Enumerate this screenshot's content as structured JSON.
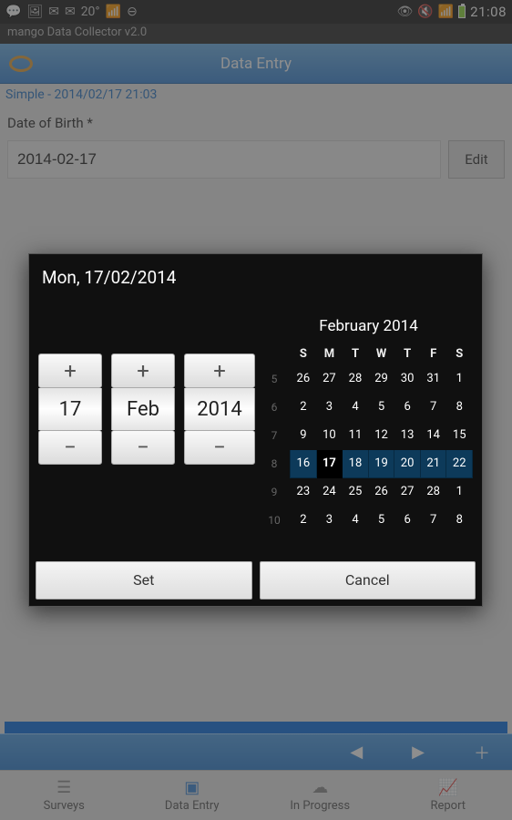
{
  "status": {
    "temp": "20°",
    "clock": "21:08"
  },
  "app": {
    "title": "mango Data Collector v2.0",
    "header": "Data Entry",
    "breadcrumb": "Simple - 2014/02/17 21:03"
  },
  "form": {
    "dob_label": "Date of Birth *",
    "dob_value": "2014-02-17",
    "edit_label": "Edit"
  },
  "tabs": {
    "surveys": "Surveys",
    "data_entry": "Data Entry",
    "in_progress": "In Progress",
    "report": "Report"
  },
  "dialog": {
    "title": "Mon, 17/02/2014",
    "day": "17",
    "month": "Feb",
    "year": "2014",
    "set_label": "Set",
    "cancel_label": "Cancel"
  },
  "calendar": {
    "title": "February 2014",
    "dow": [
      "S",
      "M",
      "T",
      "W",
      "T",
      "F",
      "S"
    ],
    "weeks": [
      {
        "wk": "5",
        "days": [
          {
            "d": "26",
            "dim": true
          },
          {
            "d": "27",
            "dim": true
          },
          {
            "d": "28",
            "dim": true
          },
          {
            "d": "29",
            "dim": true
          },
          {
            "d": "30",
            "dim": true
          },
          {
            "d": "31",
            "dim": true
          },
          {
            "d": "1"
          }
        ]
      },
      {
        "wk": "6",
        "days": [
          {
            "d": "2"
          },
          {
            "d": "3"
          },
          {
            "d": "4"
          },
          {
            "d": "5"
          },
          {
            "d": "6"
          },
          {
            "d": "7"
          },
          {
            "d": "8"
          }
        ]
      },
      {
        "wk": "7",
        "days": [
          {
            "d": "9"
          },
          {
            "d": "10"
          },
          {
            "d": "11"
          },
          {
            "d": "12"
          },
          {
            "d": "13"
          },
          {
            "d": "14"
          },
          {
            "d": "15"
          }
        ]
      },
      {
        "wk": "8",
        "cur": true,
        "days": [
          {
            "d": "16"
          },
          {
            "d": "17",
            "sel": true
          },
          {
            "d": "18"
          },
          {
            "d": "19"
          },
          {
            "d": "20"
          },
          {
            "d": "21"
          },
          {
            "d": "22"
          }
        ]
      },
      {
        "wk": "9",
        "days": [
          {
            "d": "23"
          },
          {
            "d": "24"
          },
          {
            "d": "25"
          },
          {
            "d": "26"
          },
          {
            "d": "27"
          },
          {
            "d": "28"
          },
          {
            "d": "1",
            "dim": true
          }
        ]
      },
      {
        "wk": "10",
        "days": [
          {
            "d": "2",
            "dim": true
          },
          {
            "d": "3",
            "dim": true
          },
          {
            "d": "4",
            "dim": true
          },
          {
            "d": "5",
            "dim": true
          },
          {
            "d": "6",
            "dim": true
          },
          {
            "d": "7",
            "dim": true
          },
          {
            "d": "8",
            "dim": true
          }
        ]
      }
    ]
  }
}
